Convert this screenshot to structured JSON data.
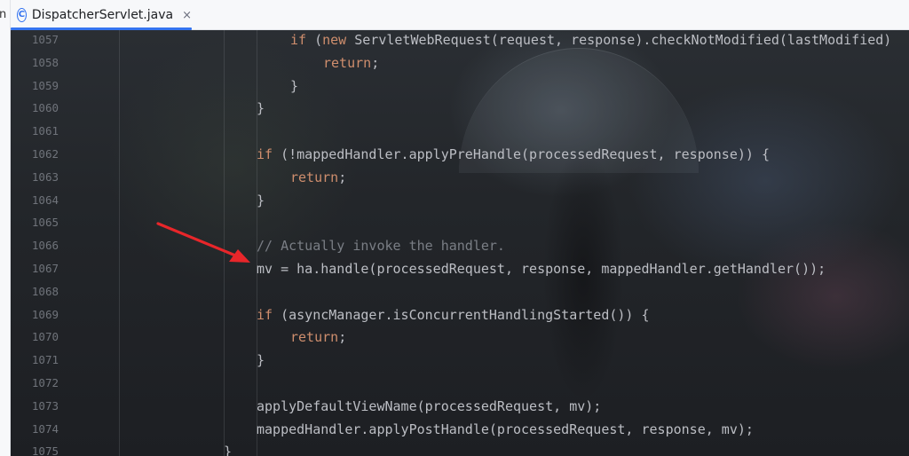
{
  "tab": {
    "icon_letter": "C",
    "icon": "java-class-icon",
    "label": "DispatcherServlet.java",
    "close_glyph": "×"
  },
  "left_strip_glyph": "n",
  "colors": {
    "keyword": "#cf8e6d",
    "comment": "#7a7e85",
    "text": "#bcbec4",
    "line_number": "#6f737a",
    "active_tab_underline": "#3574f0",
    "arrow": "#e8262a"
  },
  "lines": [
    {
      "num": "1057",
      "indent": 2,
      "tokens": [
        {
          "t": "if",
          "c": "kw"
        },
        {
          "t": " ("
        },
        {
          "t": "new",
          "c": "kw"
        },
        {
          "t": " ServletWebRequest(request, response).checkNotModified(lastModified)"
        }
      ]
    },
    {
      "num": "1058",
      "indent": 3,
      "tokens": [
        {
          "t": "return",
          "c": "kw"
        },
        {
          "t": ";"
        }
      ]
    },
    {
      "num": "1059",
      "indent": 2,
      "tokens": [
        {
          "t": "}"
        }
      ]
    },
    {
      "num": "1060",
      "indent": 1,
      "tokens": [
        {
          "t": "}"
        }
      ]
    },
    {
      "num": "1061",
      "indent": 0,
      "tokens": []
    },
    {
      "num": "1062",
      "indent": 1,
      "tokens": [
        {
          "t": "if",
          "c": "kw"
        },
        {
          "t": " (!mappedHandler.applyPreHandle(processedRequest, response)) {"
        }
      ]
    },
    {
      "num": "1063",
      "indent": 2,
      "tokens": [
        {
          "t": "return",
          "c": "kw"
        },
        {
          "t": ";"
        }
      ]
    },
    {
      "num": "1064",
      "indent": 1,
      "tokens": [
        {
          "t": "}"
        }
      ]
    },
    {
      "num": "1065",
      "indent": 0,
      "tokens": []
    },
    {
      "num": "1066",
      "indent": 1,
      "tokens": [
        {
          "t": "// Actually invoke the handler.",
          "c": "cm"
        }
      ]
    },
    {
      "num": "1067",
      "indent": 1,
      "tokens": [
        {
          "t": "mv = ha.handle(processedRequest, response, mappedHandler.getHandler());"
        }
      ]
    },
    {
      "num": "1068",
      "indent": 0,
      "tokens": []
    },
    {
      "num": "1069",
      "indent": 1,
      "tokens": [
        {
          "t": "if",
          "c": "kw"
        },
        {
          "t": " (asyncManager.isConcurrentHandlingStarted()) {"
        }
      ]
    },
    {
      "num": "1070",
      "indent": 2,
      "tokens": [
        {
          "t": "return",
          "c": "kw"
        },
        {
          "t": ";"
        }
      ]
    },
    {
      "num": "1071",
      "indent": 1,
      "tokens": [
        {
          "t": "}"
        }
      ]
    },
    {
      "num": "1072",
      "indent": 0,
      "tokens": []
    },
    {
      "num": "1073",
      "indent": 1,
      "tokens": [
        {
          "t": "applyDefaultViewName(processedRequest, mv);"
        }
      ]
    },
    {
      "num": "1074",
      "indent": 1,
      "tokens": [
        {
          "t": "mappedHandler.applyPostHandle(processedRequest, response, mv);"
        }
      ]
    },
    {
      "num": "1075",
      "indent": 0,
      "tokens": [
        {
          "t": "}"
        }
      ]
    }
  ],
  "annotation": {
    "type": "arrow",
    "points_to_line": "1067"
  }
}
